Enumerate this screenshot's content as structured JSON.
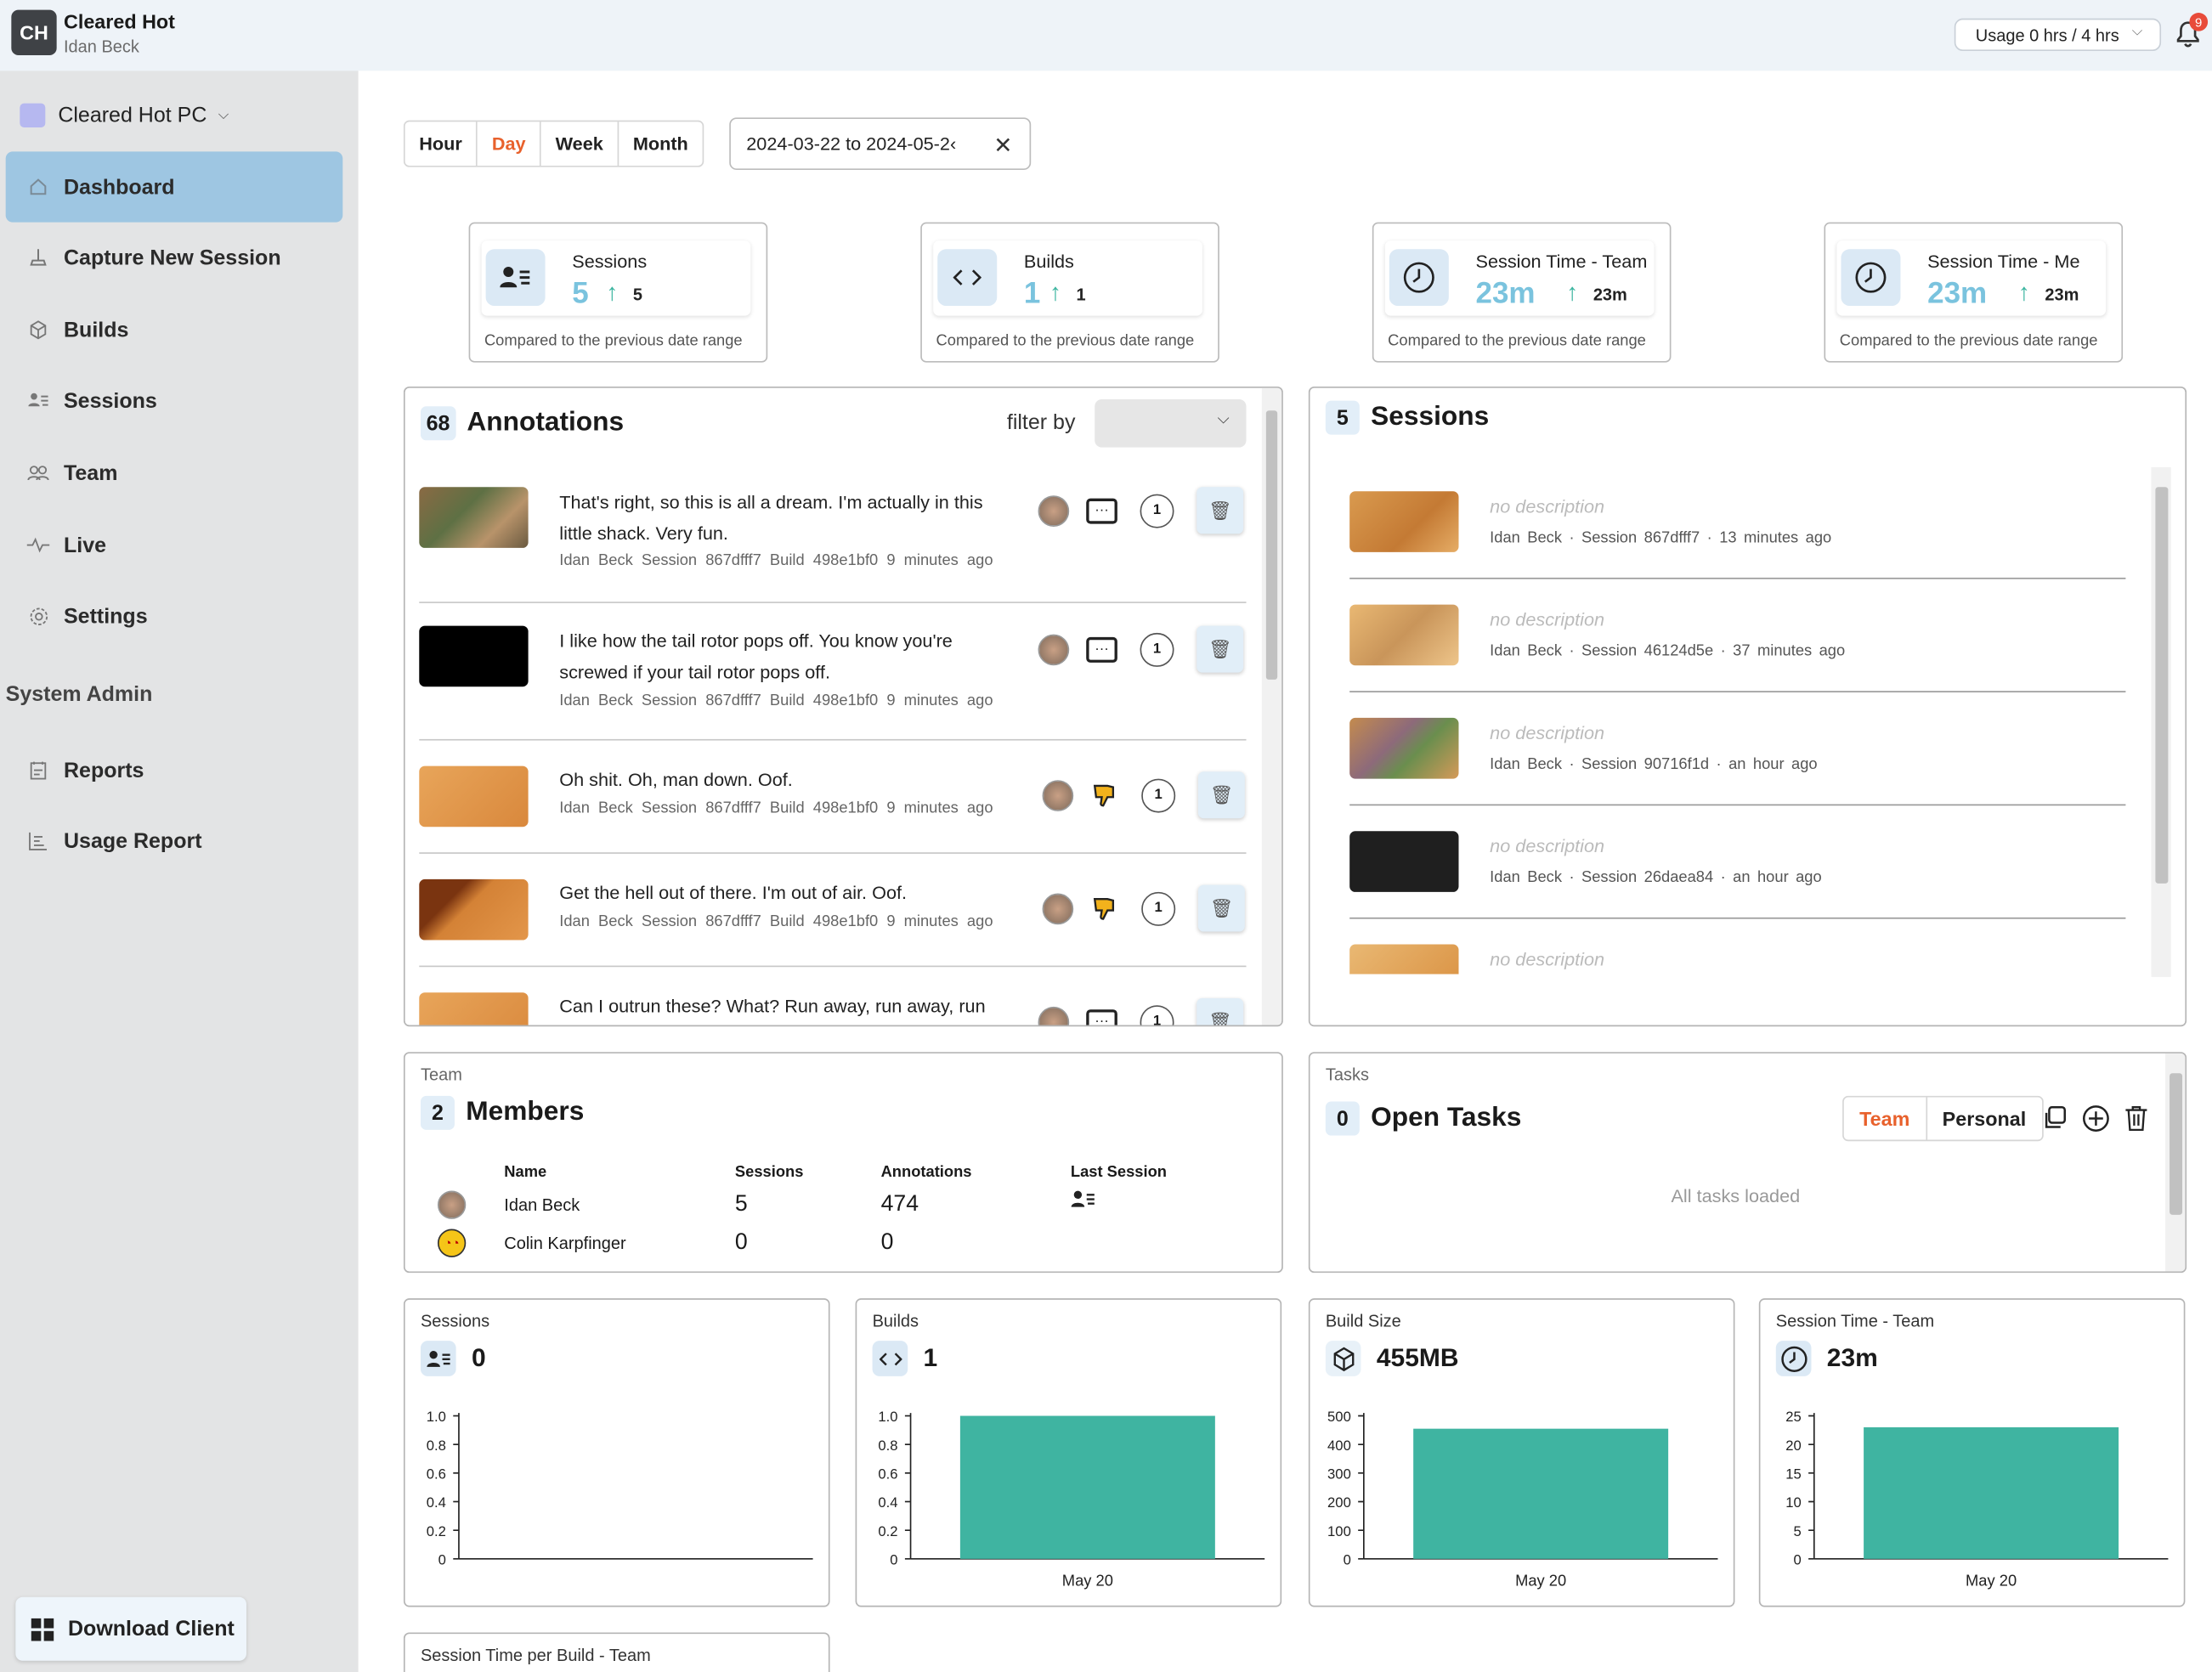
{
  "header": {
    "logo_text": "CH",
    "org": "Cleared Hot",
    "user": "Idan Beck",
    "usage": "Usage 0 hrs / 4 hrs",
    "notif_count": "9"
  },
  "sidebar": {
    "workspace": "Cleared Hot PC",
    "items": [
      {
        "label": "Dashboard",
        "icon": "home-icon"
      },
      {
        "label": "Capture New Session",
        "icon": "capture-icon"
      },
      {
        "label": "Builds",
        "icon": "box-icon"
      },
      {
        "label": "Sessions",
        "icon": "sessions-icon"
      },
      {
        "label": "Team",
        "icon": "team-icon"
      },
      {
        "label": "Live",
        "icon": "pulse-icon"
      },
      {
        "label": "Settings",
        "icon": "gear-icon"
      }
    ],
    "section": "System Admin",
    "admin_items": [
      {
        "label": "Reports",
        "icon": "reports-icon"
      },
      {
        "label": "Usage Report",
        "icon": "usage-report-icon"
      }
    ],
    "download": "Download Client"
  },
  "range": {
    "tabs": [
      "Hour",
      "Day",
      "Week",
      "Month"
    ],
    "active": "Day",
    "value": "2024-03-22 to 2024-05-2‹"
  },
  "stats": [
    {
      "label": "Sessions",
      "value": "5",
      "delta": "5",
      "note": "Compared to the previous date range"
    },
    {
      "label": "Builds",
      "value": "1",
      "delta": "1",
      "note": "Compared to the previous date range"
    },
    {
      "label": "Session Time - Team",
      "value": "23m",
      "delta": "23m",
      "note": "Compared to the previous date range"
    },
    {
      "label": "Session Time - Me",
      "value": "23m",
      "delta": "23m",
      "note": "Compared to the previous date range"
    }
  ],
  "annotations": {
    "count": "68",
    "title": "Annotations",
    "filter_label": "filter by",
    "items": [
      {
        "text": "That's right, so this is all a dream. I'm actually in this little shack. Very fun.",
        "user": "Idan Beck",
        "session": "Session 867dfff7",
        "build": "Build 498e1bf0",
        "time": "9 minutes ago",
        "count": "1",
        "kind": "comment"
      },
      {
        "text": "I like how the tail rotor pops off. You know you're screwed if your tail rotor pops off.",
        "user": "Idan Beck",
        "session": "Session 867dfff7",
        "build": "Build 498e1bf0",
        "time": "9 minutes ago",
        "count": "1",
        "kind": "comment"
      },
      {
        "text": "Oh shit. Oh, man down. Oof.",
        "user": "Idan Beck",
        "session": "Session 867dfff7",
        "build": "Build 498e1bf0",
        "time": "9 minutes ago",
        "count": "1",
        "kind": "dislike"
      },
      {
        "text": "Get the hell out of there. I'm out of air. Oof.",
        "user": "Idan Beck",
        "session": "Session 867dfff7",
        "build": "Build 498e1bf0",
        "time": "9 minutes ago",
        "count": "1",
        "kind": "dislike"
      },
      {
        "text": "Can I outrun these? What? Run away, run away, run",
        "count": "1",
        "kind": "comment"
      }
    ]
  },
  "sessions": {
    "count": "5",
    "title": "Sessions",
    "items": [
      {
        "desc": "no description",
        "user": "Idan Beck",
        "session": "Session 867dfff7",
        "time": "13 minutes ago"
      },
      {
        "desc": "no description",
        "user": "Idan Beck",
        "session": "Session 46124d5e",
        "time": "37 minutes ago"
      },
      {
        "desc": "no description",
        "user": "Idan Beck",
        "session": "Session 90716f1d",
        "time": "an hour ago"
      },
      {
        "desc": "no description",
        "user": "Idan Beck",
        "session": "Session 26daea84",
        "time": "an hour ago"
      },
      {
        "desc": "no description"
      }
    ]
  },
  "team": {
    "section": "Team",
    "count": "2",
    "title": "Members",
    "columns": [
      "Name",
      "Sessions",
      "Annotations",
      "Last Session"
    ],
    "rows": [
      {
        "name": "Idan Beck",
        "sessions": "5",
        "annotations": "474"
      },
      {
        "name": "Colin Karpfinger",
        "sessions": "0",
        "annotations": "0"
      }
    ]
  },
  "tasks": {
    "section": "Tasks",
    "count": "0",
    "title": "Open Tasks",
    "tabs": [
      "Team",
      "Personal"
    ],
    "active": "Team",
    "empty": "All tasks loaded"
  },
  "charts": {
    "bottom_title": "Session Time per Build - Team"
  },
  "chart_data": [
    {
      "type": "bar",
      "title": "Sessions",
      "summary": "0",
      "categories": [],
      "values": [],
      "ylim": [
        0,
        1.0
      ],
      "yticks": [
        "1.0",
        "0.8",
        "0.6",
        "0.4",
        "0.2",
        "0"
      ]
    },
    {
      "type": "bar",
      "title": "Builds",
      "summary": "1",
      "categories": [
        "May 20"
      ],
      "values": [
        1
      ],
      "ylim": [
        0,
        1.0
      ],
      "yticks": [
        "1.0",
        "0.8",
        "0.6",
        "0.4",
        "0.2",
        "0"
      ],
      "color": "#3fb4a1"
    },
    {
      "type": "bar",
      "title": "Build Size",
      "summary": "455MB",
      "categories": [
        "May 20"
      ],
      "values": [
        455
      ],
      "ylim": [
        0,
        500
      ],
      "yticks": [
        "500",
        "400",
        "300",
        "200",
        "100",
        "0"
      ],
      "color": "#3fb4a1"
    },
    {
      "type": "bar",
      "title": "Session Time - Team",
      "summary": "23m",
      "categories": [
        "May 20"
      ],
      "values": [
        23
      ],
      "ylim": [
        0,
        25
      ],
      "yticks": [
        "25",
        "20",
        "15",
        "10",
        "5",
        "0"
      ],
      "color": "#3fb4a1"
    }
  ]
}
